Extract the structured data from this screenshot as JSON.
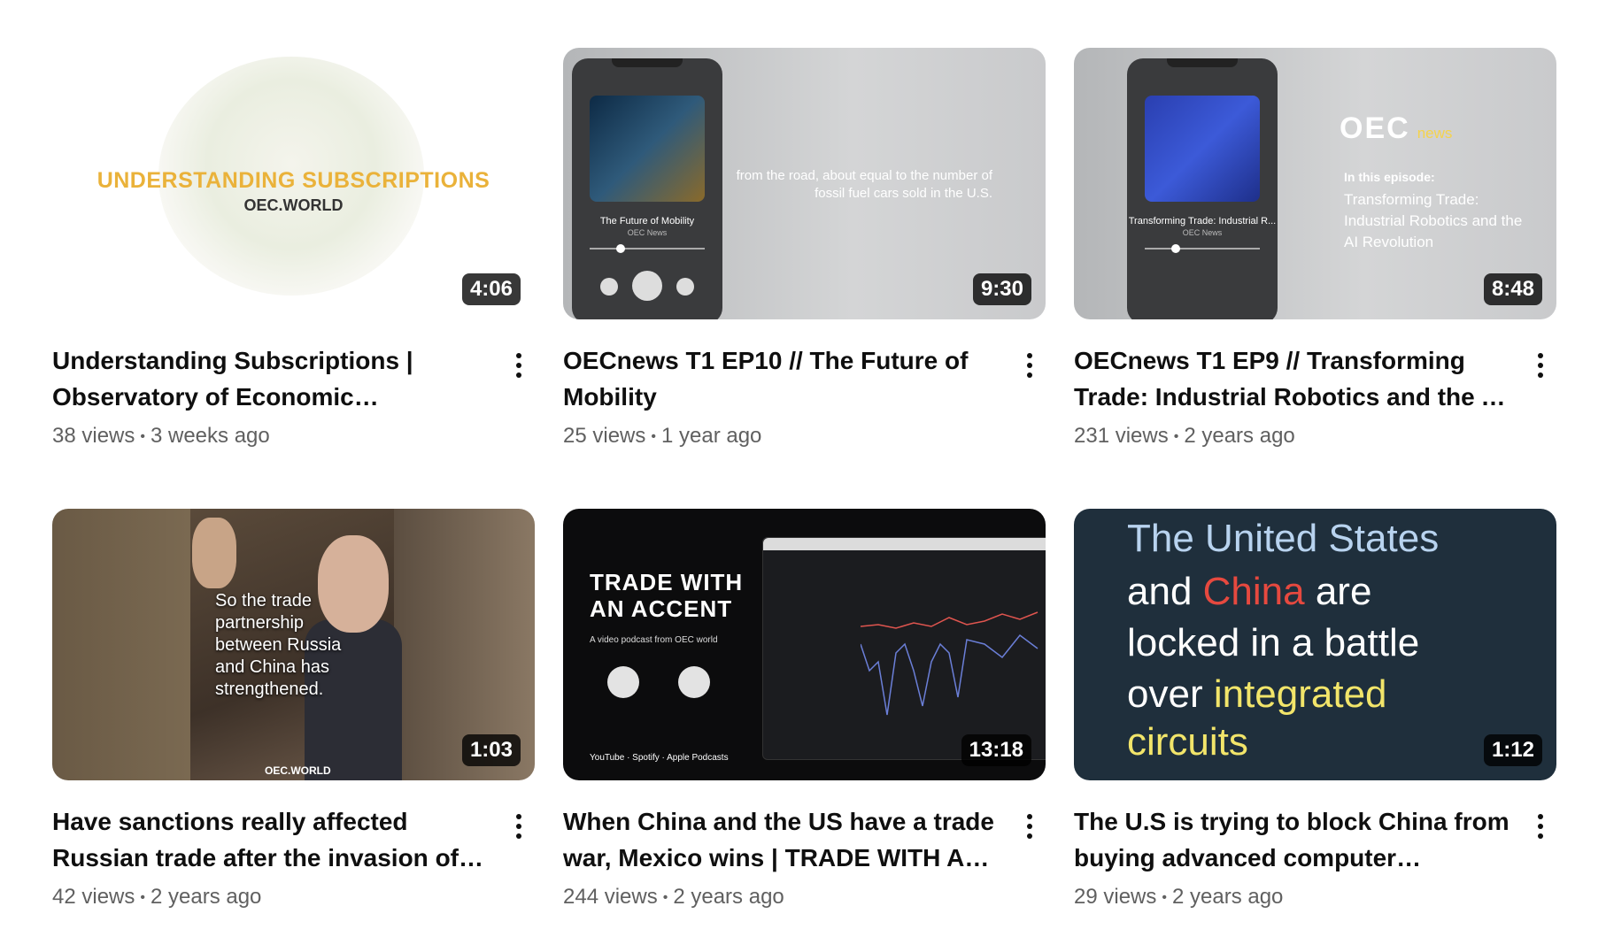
{
  "videos": [
    {
      "title": "Understanding Subscriptions | Observatory of Economic Complexity (OEC)",
      "views": "38 views",
      "age": "3 weeks ago",
      "duration": "4:06",
      "thumb": {
        "heading": "UNDERSTANDING SUBSCRIPTIONS",
        "sub": "OEC.WORLD"
      }
    },
    {
      "title": "OECnews T1 EP10 // The Future of Mobility",
      "views": "25 views",
      "age": "1 year ago",
      "duration": "9:30",
      "thumb": {
        "quote": "from the road, about equal to the number of fossil fuel cars sold in the U.S.",
        "phone_title": "The Future of Mobility",
        "phone_sub": "OEC News"
      }
    },
    {
      "title": "OECnews T1 EP9 // Transforming Trade: Industrial Robotics and the AI Revolution",
      "views": "231 views",
      "age": "2 years ago",
      "duration": "8:48",
      "thumb": {
        "logo": "OEC",
        "logo_tag": "news",
        "ep_label": "In this episode:",
        "ep_text": "Transforming Trade: Industrial Robotics and the AI Revolution",
        "phone_title": "Transforming Trade: Industrial R...",
        "phone_sub": "OEC News"
      }
    },
    {
      "title": "Have sanctions really affected Russian trade after the invasion of Ukraine?",
      "views": "42 views",
      "age": "2 years ago",
      "duration": "1:03",
      "thumb": {
        "caption": "So the trade partnership between Russia and China has strengthened.",
        "brand": "OEC.WORLD"
      }
    },
    {
      "title": "When China and the US have a trade war, Mexico wins | TRADE WITH AN ACCENT",
      "views": "244 views",
      "age": "2 years ago",
      "duration": "13:18",
      "thumb": {
        "heading_1": "TRADE WITH",
        "heading_2": "AN ACCENT",
        "sub": "A video podcast from OEC world",
        "logos": "YouTube · Spotify · Apple Podcasts"
      }
    },
    {
      "title": "The U.S is trying to block China from buying advanced computer technology",
      "views": "29 views",
      "age": "2 years ago",
      "duration": "1:12",
      "thumb": {
        "line1": "The United States",
        "line2a": "and ",
        "line2b": "China",
        "line2c": " are",
        "line3": "locked in a battle",
        "line4a": "over ",
        "line4b": "integrated",
        "line5": "circuits"
      }
    }
  ]
}
